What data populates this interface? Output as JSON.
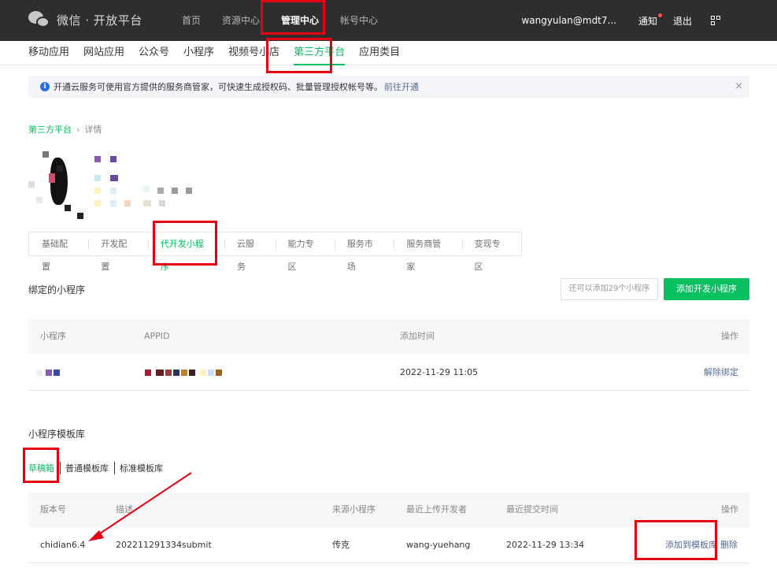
{
  "topbar": {
    "logo_text": "微信 · 开放平台",
    "nav": [
      {
        "label": "首页"
      },
      {
        "label": "资源中心"
      },
      {
        "label": "管理中心"
      },
      {
        "label": "帐号中心"
      }
    ],
    "active_nav": "管理中心",
    "user": "wangyulan@mdt7...",
    "notice": "通知",
    "logout": "退出"
  },
  "subnav": {
    "items": [
      {
        "label": "移动应用"
      },
      {
        "label": "网站应用"
      },
      {
        "label": "公众号"
      },
      {
        "label": "小程序"
      },
      {
        "label": "视频号小店"
      },
      {
        "label": "第三方平台"
      },
      {
        "label": "应用类目"
      }
    ],
    "active": "第三方平台"
  },
  "banner": {
    "text": "开通云服务可使用官方提供的服务商管家，可快速生成授权码、批量管理授权帐号等。",
    "link": "前往开通",
    "close": "×"
  },
  "breadcrumb": {
    "parent": "第三方平台",
    "separator": "›",
    "current": "详情"
  },
  "detail_tabs": {
    "items": [
      {
        "label": "基础配置"
      },
      {
        "label": "开发配置"
      },
      {
        "label": "代开发小程序"
      },
      {
        "label": "云服务"
      },
      {
        "label": "能力专区"
      },
      {
        "label": "服务市场"
      },
      {
        "label": "服务商管家"
      },
      {
        "label": "变现专区"
      }
    ],
    "active": "代开发小程序"
  },
  "bound": {
    "title": "绑定的小程序",
    "remaining": "还可以添加29个小程序",
    "add_button": "添加开发小程序",
    "columns": [
      "小程序",
      "APPID",
      "添加时间",
      "操作"
    ],
    "rows": [
      {
        "add_time": "2022-11-29 11:05",
        "action": "解除绑定"
      }
    ]
  },
  "templates": {
    "title": "小程序模板库",
    "tabs": [
      {
        "label": "草稿箱"
      },
      {
        "label": "普通模板库"
      },
      {
        "label": "标准模板库"
      }
    ],
    "active_tab": "草稿箱",
    "columns": [
      "版本号",
      "描述",
      "来源小程序",
      "最近上传开发者",
      "最近提交时间",
      "操作"
    ],
    "rows": [
      {
        "version": "chidian6.4",
        "description": "202211291334submit",
        "source": "传克",
        "developer": "wang-yuehang",
        "submit_time": "2022-11-29 13:34",
        "action_add": "添加到模板库",
        "action_delete": "删除"
      }
    ]
  },
  "colors": {
    "accent": "#07c160",
    "topbar": "#2e2e2e",
    "link": "#576b95",
    "annotation": "#e60012"
  }
}
